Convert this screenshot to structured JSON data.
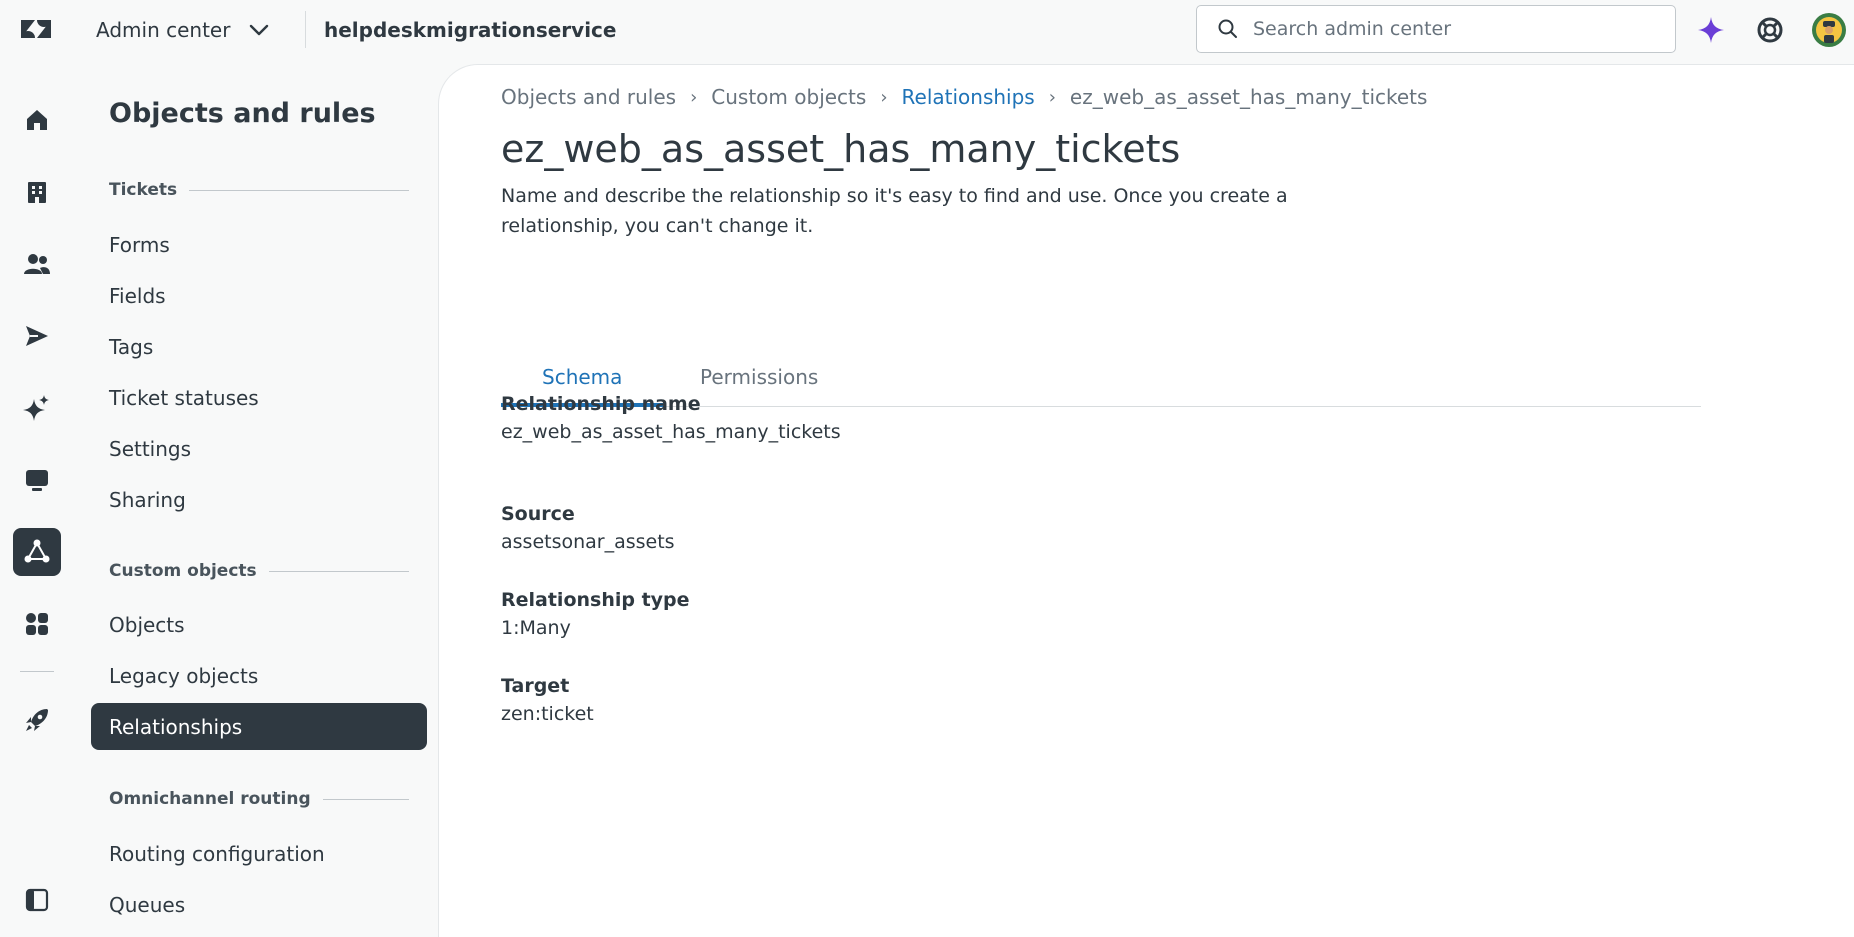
{
  "header": {
    "product_name": "Admin center",
    "account_name": "helpdeskmigrationservice",
    "search_placeholder": "Search admin center"
  },
  "colors": {
    "accent_blue": "#1f73b7",
    "dark_nav": "#2f3941",
    "ai_purple": "#6a3ed6"
  },
  "rail": {
    "items": [
      {
        "icon": "home-icon"
      },
      {
        "icon": "building-icon"
      },
      {
        "icon": "people-icon"
      },
      {
        "icon": "send-icon"
      },
      {
        "icon": "sparkle-icon"
      },
      {
        "icon": "workspace-icon"
      },
      {
        "icon": "objects-rules-icon"
      },
      {
        "icon": "apps-icon"
      },
      {
        "icon": "rocket-icon"
      },
      {
        "icon": "collapse-panel-icon"
      }
    ]
  },
  "subnav": {
    "title": "Objects and rules",
    "sections": [
      {
        "heading": "Tickets",
        "items": [
          "Forms",
          "Fields",
          "Tags",
          "Ticket statuses",
          "Settings",
          "Sharing"
        ]
      },
      {
        "heading": "Custom objects",
        "items": [
          "Objects",
          "Legacy objects",
          "Relationships"
        ]
      },
      {
        "heading": "Omnichannel routing",
        "items": [
          "Routing configuration",
          "Queues"
        ]
      }
    ],
    "active_item": "Relationships"
  },
  "breadcrumb": [
    "Objects and rules",
    "Custom objects",
    "Relationships",
    "ez_web_as_asset_has_many_tickets"
  ],
  "page": {
    "title": "ez_web_as_asset_has_many_tickets",
    "description": "Name and describe the relationship so it's easy to find and use. Once you create a relationship, you can't change it."
  },
  "tabs": [
    "Schema",
    "Permissions"
  ],
  "active_tab": "Schema",
  "fields": [
    {
      "label": "Relationship name",
      "value": "ez_web_as_asset_has_many_tickets"
    },
    {
      "label": "Source",
      "value": "assetsonar_assets"
    },
    {
      "label": "Relationship type",
      "value": "1:Many"
    },
    {
      "label": "Target",
      "value": "zen:ticket"
    }
  ]
}
